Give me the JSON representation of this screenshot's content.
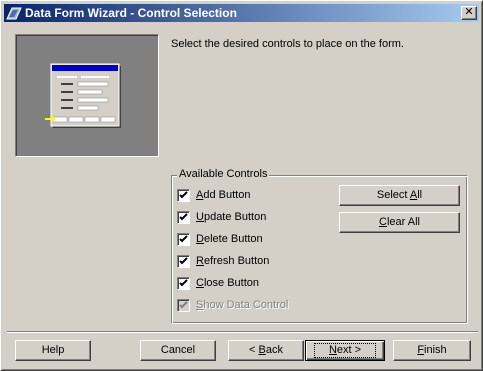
{
  "window": {
    "title": "Data Form Wizard - Control Selection",
    "close_glyph": "✕"
  },
  "instruction": "Select the desired controls to place on the form.",
  "group": {
    "legend": "Available Controls",
    "items": [
      {
        "label": "Add Button",
        "mnemonic": "A",
        "rest": "dd Button",
        "checked": true,
        "enabled": true
      },
      {
        "label": "Update Button",
        "mnemonic": "U",
        "rest": "pdate Button",
        "checked": true,
        "enabled": true
      },
      {
        "label": "Delete Button",
        "mnemonic": "D",
        "rest": "elete Button",
        "checked": true,
        "enabled": true
      },
      {
        "label": "Refresh Button",
        "mnemonic": "R",
        "rest": "efresh Button",
        "checked": true,
        "enabled": true
      },
      {
        "label": "Close Button",
        "mnemonic": "C",
        "rest": "lose Button",
        "checked": true,
        "enabled": true
      },
      {
        "label": "Show Data Control",
        "mnemonic": "S",
        "rest": "how Data Control",
        "checked": true,
        "enabled": false
      }
    ],
    "select_all": {
      "pre": "Select ",
      "mnemonic": "A",
      "post": "ll"
    },
    "clear_all": {
      "pre": "",
      "mnemonic": "C",
      "post": "lear All"
    }
  },
  "buttons": {
    "help": "Help",
    "cancel": "Cancel",
    "back": {
      "pre": "< ",
      "mnemonic": "B",
      "post": "ack"
    },
    "next": {
      "pre": "",
      "mnemonic": "N",
      "post": "ext >"
    },
    "finish": {
      "pre": "",
      "mnemonic": "F",
      "post": "inish"
    }
  },
  "icons": {
    "app": "data-form-wizard-icon",
    "preview": "form-preview-illustration"
  },
  "colors": {
    "title_start": "#0a246a",
    "title_end": "#a6caf0",
    "face": "#d4d0c8",
    "preview_bg": "#808080"
  }
}
